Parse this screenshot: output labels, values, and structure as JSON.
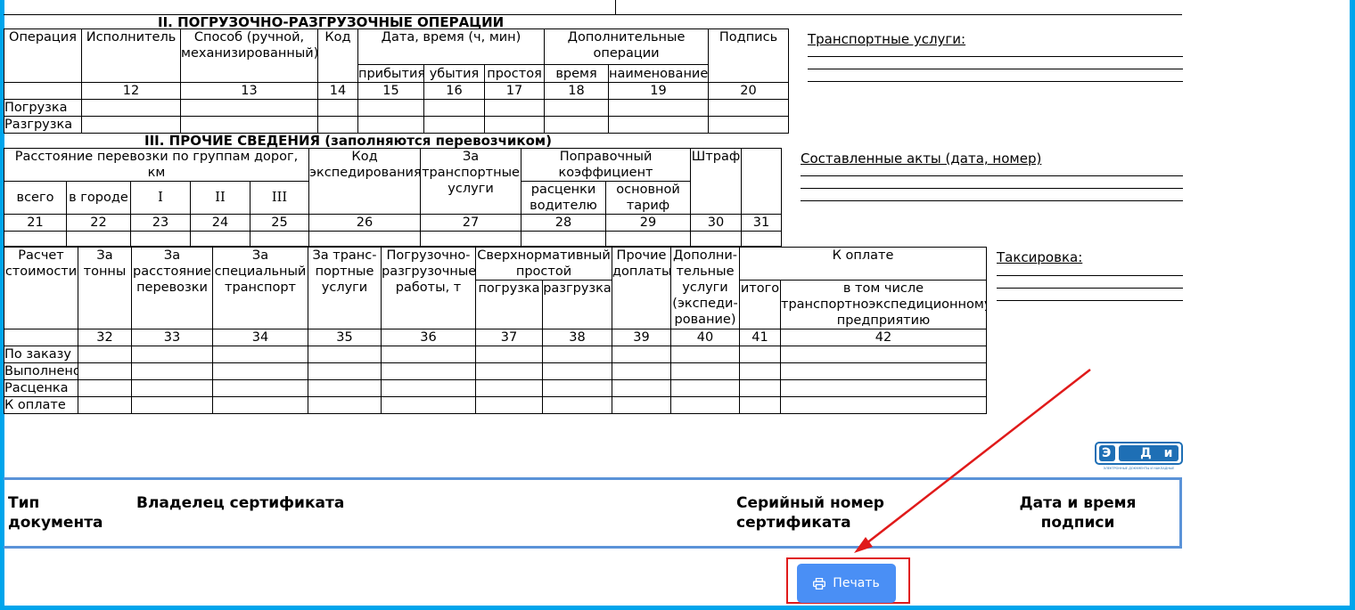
{
  "section2": {
    "title": "II. ПОГРУЗОЧНО-РАЗГРУЗОЧНЫЕ ОПЕРАЦИИ",
    "headers": {
      "operation": "Операция",
      "executor": "Исполнитель",
      "method": "Способ (ручной, механизированный)",
      "code": "Код",
      "datetime": "Дата, время (ч, мин)",
      "arrival": "прибытия",
      "departure": "убытия",
      "idle": "простоя",
      "extra_ops": "Дополнительные операции",
      "time": "время",
      "name": "наименование",
      "signature": "Подпись"
    },
    "numbers": [
      "12",
      "13",
      "14",
      "15",
      "16",
      "17",
      "18",
      "19",
      "20"
    ],
    "rows": [
      "Погрузка",
      "Разгрузка"
    ],
    "side_label": "Транспортные услуги:"
  },
  "section3": {
    "title": "III. ПРОЧИЕ СВЕДЕНИЯ (заполняются перевозчиком)",
    "headers": {
      "distance": "Расстояние перевозки по группам дорог, км",
      "total": "всего",
      "in_city": "в городе",
      "g1": "I",
      "g2": "II",
      "g3": "III",
      "exp_code": "Код экспедирования",
      "transport_services": "За транспортные услуги",
      "coef": "Поправочный коэффициент",
      "driver_rates": "расценки водителю",
      "main_tariff": "основной тариф",
      "fine": "Штраф"
    },
    "numbers": [
      "21",
      "22",
      "23",
      "24",
      "25",
      "26",
      "27",
      "28",
      "29",
      "30",
      "31"
    ],
    "side_label": "Составленные акты (дата, номер)"
  },
  "section4": {
    "headers": {
      "calc": "Расчет стоимости",
      "tons": "За тонны",
      "distance": "За расстояние перевозки",
      "special": "За специальный транспорт",
      "transport": "За транс-портные услуги",
      "loading_works": "Погрузочно-разгрузочные работы, т",
      "excess_idle": "Сверхнормативный простой",
      "loading": "погрузка",
      "unloading": "разгрузка",
      "other": "Прочие доплаты",
      "additional": "Дополни-тельные услуги (экспеди-рование)",
      "to_pay": "К оплате",
      "total": "итого",
      "including": "в том числе транспортноэкспедиционному предприятию"
    },
    "numbers": [
      "32",
      "33",
      "34",
      "35",
      "36",
      "37",
      "38",
      "39",
      "40",
      "41",
      "42"
    ],
    "rows": [
      "По заказу",
      "Выполнено",
      "Расценка",
      "К оплате"
    ],
    "side_label": "Таксировка:"
  },
  "logo": {
    "text": "Э ДиН",
    "caption": "ЭЛЕКТРОННЫЕ ДОКУМЕНТЫ И НАКЛАДНЫЕ"
  },
  "signature": {
    "doc_type": "Тип документа",
    "owner": "Владелец сертификата",
    "serial": "Серийный номер сертификата",
    "datetime": "Дата и время подписи"
  },
  "print_button": {
    "label": "Печать",
    "icon": "printer-icon"
  },
  "colors": {
    "frame": "#00a5ec",
    "button": "#4a8ff5",
    "highlight": "#e01a1a",
    "sigbox": "#5b93d8"
  }
}
